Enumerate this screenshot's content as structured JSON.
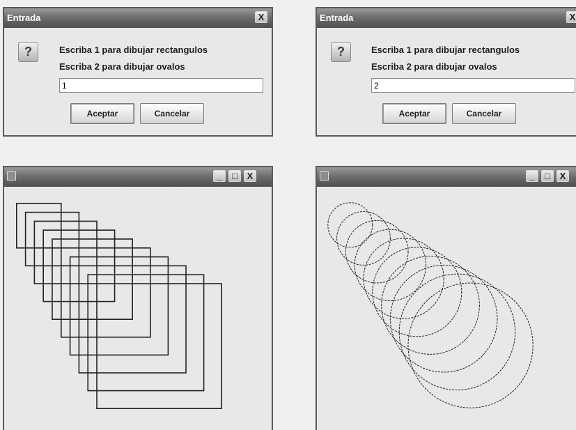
{
  "dialogs": [
    {
      "title": "Entrada",
      "close_glyph": "X",
      "icon": "question-icon",
      "icon_glyph": "?",
      "message_line1": "Escriba 1 para dibujar rectangulos",
      "message_line2": "Escriba 2 para dibujar ovalos",
      "input_value": "1",
      "ok_label": "Aceptar",
      "cancel_label": "Cancelar"
    },
    {
      "title": "Entrada",
      "close_glyph": "X",
      "icon": "question-icon",
      "icon_glyph": "?",
      "message_line1": "Escriba 1 para dibujar rectangulos",
      "message_line2": "Escriba 2 para dibujar ovalos",
      "input_value": "2",
      "ok_label": "Aceptar",
      "cancel_label": "Cancelar"
    }
  ],
  "frames": [
    {
      "title": "",
      "minimize_glyph": "_",
      "maximize_glyph": "□",
      "close_glyph": "X",
      "drawing": "rectangles",
      "shape_count": 10
    },
    {
      "title": "",
      "minimize_glyph": "_",
      "maximize_glyph": "□",
      "close_glyph": "X",
      "drawing": "ovals",
      "shape_count": 10
    }
  ],
  "colors": {
    "titlebar": "#6f6f6f",
    "content": "#e8e8e8",
    "stroke": "#222222"
  }
}
